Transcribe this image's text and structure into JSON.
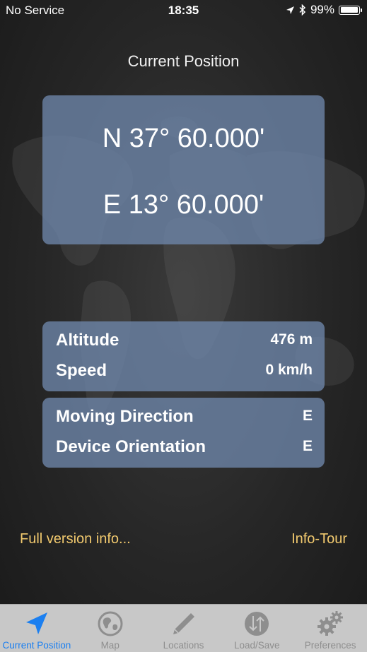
{
  "status_bar": {
    "carrier": "No Service",
    "time": "18:35",
    "battery_percent": "99%",
    "battery_level": 0.99
  },
  "header": {
    "title": "Current Position"
  },
  "coordinates": {
    "latitude": "N 37° 60.000'",
    "longitude": "E 13° 60.000'"
  },
  "motion_card": {
    "altitude_label": "Altitude",
    "altitude_value": "476 m",
    "speed_label": "Speed",
    "speed_value": "0 km/h"
  },
  "direction_card": {
    "moving_direction_label": "Moving Direction",
    "moving_direction_value": "E",
    "device_orientation_label": "Device Orientation",
    "device_orientation_value": "E"
  },
  "links": {
    "full_version": "Full version info...",
    "info_tour": "Info-Tour"
  },
  "tab_bar": {
    "tabs": [
      {
        "label": "Current Position",
        "icon": "location-arrow-icon",
        "active": true
      },
      {
        "label": "Map",
        "icon": "globe-icon",
        "active": false
      },
      {
        "label": "Locations",
        "icon": "pencil-icon",
        "active": false
      },
      {
        "label": "Load/Save",
        "icon": "load-save-icon",
        "active": false
      },
      {
        "label": "Preferences",
        "icon": "gears-icon",
        "active": false
      }
    ]
  },
  "colors": {
    "card_background": "#6e87aa",
    "link_color": "#f1c96e",
    "active_tab": "#1b7ff0",
    "inactive_tab": "#8e8e8e",
    "tab_bar_background": "#c8c8c8"
  }
}
